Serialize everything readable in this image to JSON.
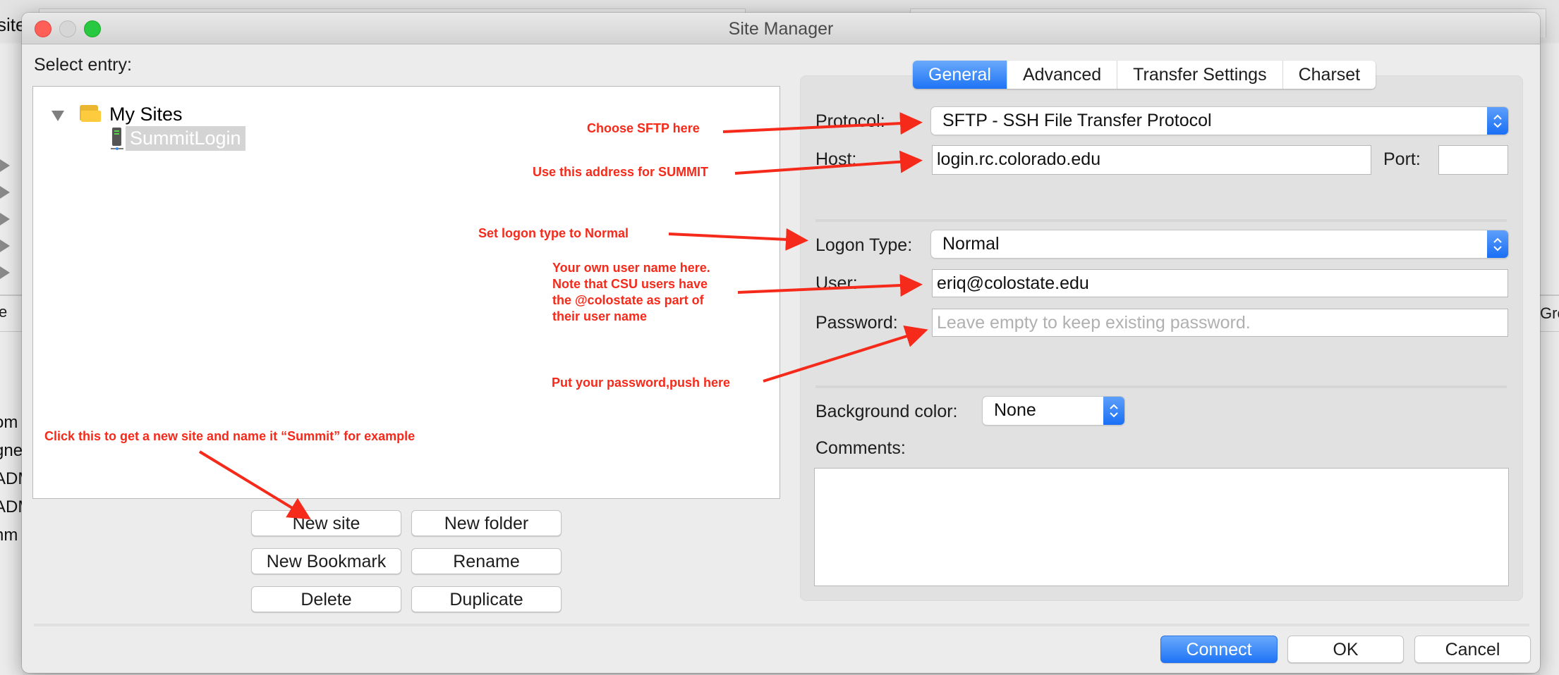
{
  "background_window": {
    "partial_title": "site",
    "left_column_header": "e",
    "left_column_fragments": [
      "om",
      "gne",
      "ADM",
      "ADM",
      "nm"
    ],
    "right_column_header": "Gro"
  },
  "dialog": {
    "title": "Site Manager",
    "window_controls": [
      "close",
      "minimize",
      "maximize"
    ],
    "select_entry_label": "Select entry:",
    "tree": {
      "root": {
        "label": "My Sites",
        "icon": "folder-icon",
        "expanded": true
      },
      "children": [
        {
          "label": "SummitLogin",
          "icon": "server-icon",
          "selected": true
        }
      ]
    },
    "tree_buttons": {
      "new_site": "New site",
      "new_folder": "New folder",
      "new_bookmark": "New Bookmark",
      "rename": "Rename",
      "delete": "Delete",
      "duplicate": "Duplicate"
    },
    "tabs": [
      {
        "label": "General",
        "active": true
      },
      {
        "label": "Advanced",
        "active": false
      },
      {
        "label": "Transfer Settings",
        "active": false
      },
      {
        "label": "Charset",
        "active": false
      }
    ],
    "general": {
      "protocol_label": "Protocol:",
      "protocol_value": "SFTP - SSH File Transfer Protocol",
      "host_label": "Host:",
      "host_value": "login.rc.colorado.edu",
      "port_label": "Port:",
      "port_value": "",
      "logon_type_label": "Logon Type:",
      "logon_type_value": "Normal",
      "user_label": "User:",
      "user_value": "eriq@colostate.edu",
      "password_label": "Password:",
      "password_placeholder": "Leave empty to keep existing password.",
      "background_color_label": "Background color:",
      "background_color_value": "None",
      "comments_label": "Comments:",
      "comments_value": ""
    },
    "footer_buttons": {
      "connect": "Connect",
      "ok": "OK",
      "cancel": "Cancel"
    }
  },
  "annotations": {
    "protocol": "Choose SFTP here",
    "host": "Use this address for SUMMIT",
    "logon_type": "Set logon type to Normal",
    "user": [
      "Your own user name here.",
      "Note that CSU users have",
      "the @colostate as part of",
      "their user name"
    ],
    "password": "Put your password,push here",
    "new_site": "Click this to get a new site and name it “Summit” for example"
  },
  "colors": {
    "accent_blue": "#1e74f6",
    "annotation_red": "#f52a1a",
    "close_red": "#fe5f57",
    "maximize_green": "#28c840"
  }
}
